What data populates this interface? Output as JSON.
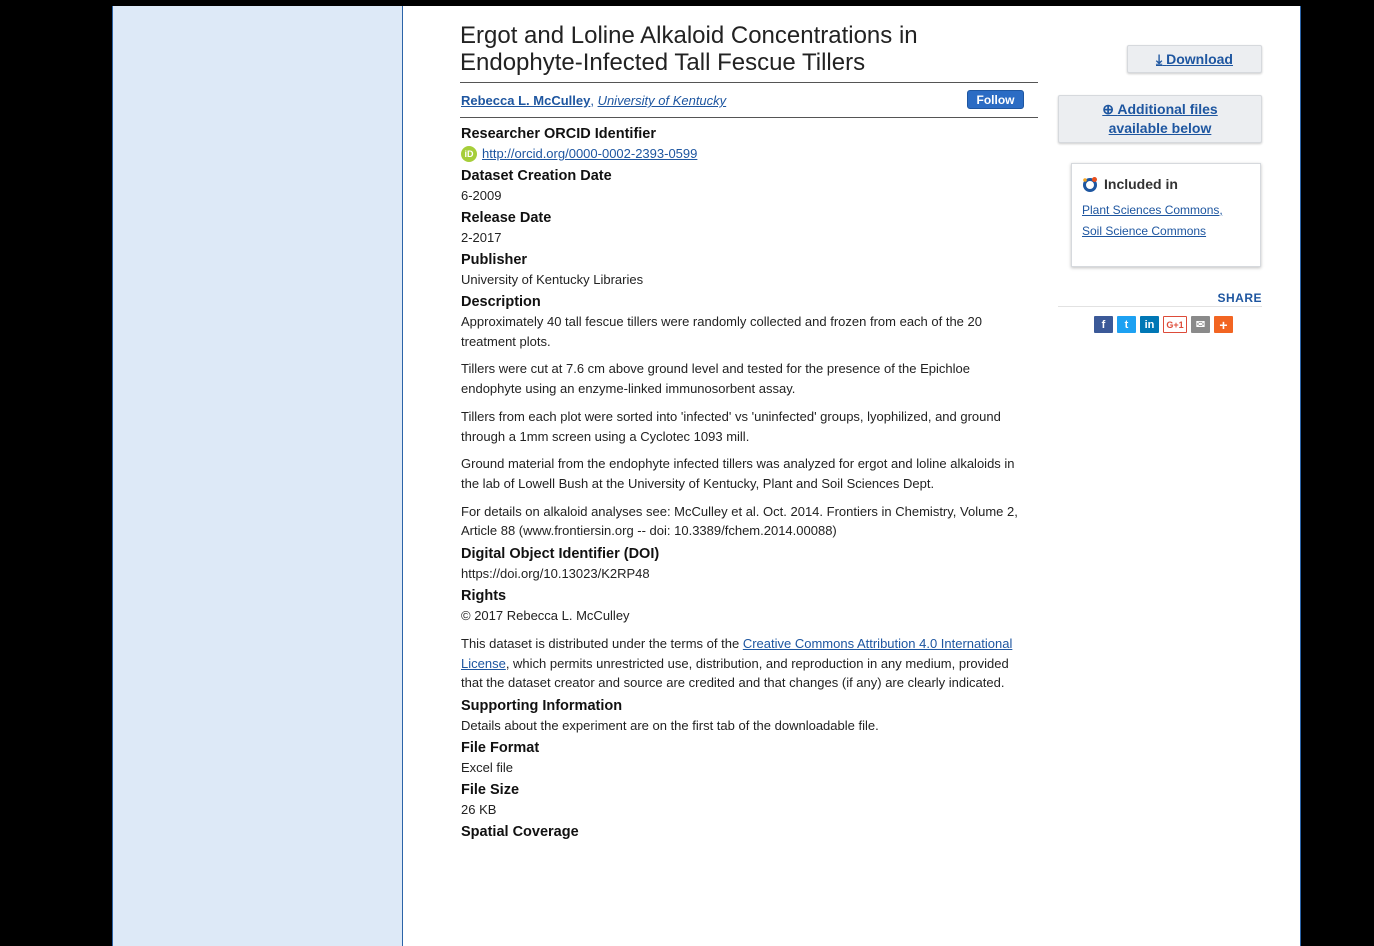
{
  "article": {
    "title_line1": "Ergot and Loline Alkaloid Concentrations in",
    "title_line2": "Endophyte-Infected Tall Fescue Tillers",
    "author_name": "Rebecca L. McCulley",
    "author_affiliation": "University of Kentucky",
    "follow_label": "Follow"
  },
  "fields": {
    "orcid_label": "Researcher ORCID Identifier",
    "orcid_badge": "iD",
    "orcid_url": "http://orcid.org/0000-0002-2393-0599",
    "creation_label": "Dataset Creation Date",
    "creation_value": "6-2009",
    "release_label": "Release Date",
    "release_value": "2-2017",
    "publisher_label": "Publisher",
    "publisher_value": "University of Kentucky Libraries",
    "description_label": "Description",
    "description_p1": "Approximately 40 tall fescue tillers were randomly collected and frozen from each of the 20 treatment plots.",
    "description_p2": "Tillers were cut at 7.6 cm above ground level and tested for the presence of the Epichloe endophyte using an enzyme-linked immunosorbent assay.",
    "description_p3": "Tillers from each plot were sorted into 'infected' vs 'uninfected' groups, lyophilized, and ground through a 1mm screen using a Cyclotec 1093 mill.",
    "description_p4": "Ground material from the endophyte infected tillers was analyzed for ergot and loline alkaloids in the lab of Lowell Bush at the University of Kentucky, Plant and Soil Sciences Dept.",
    "description_p5": "For details on alkaloid analyses see: McCulley et al. Oct. 2014. Frontiers in Chemistry, Volume 2, Article 88 (www.frontiersin.org -- doi: 10.3389/fchem.2014.00088)",
    "doi_label": "Digital Object Identifier (DOI)",
    "doi_value": "https://doi.org/10.13023/K2RP48",
    "rights_label": "Rights",
    "rights_value": "© 2017 Rebecca L. McCulley",
    "rights_text_before": "This dataset is distributed under the terms of the ",
    "rights_link": "Creative Commons Attribution 4.0 International License",
    "rights_text_after": ", which permits unrestricted use, distribution, and reproduction in any medium, provided that the dataset creator and source are credited and that changes (if any) are clearly indicated.",
    "supporting_label": "Supporting Information",
    "supporting_value": "Details about the experiment are on the first tab of the downloadable file.",
    "format_label": "File Format",
    "format_value": "Excel file",
    "size_label": "File Size",
    "size_value": "26 KB",
    "spatial_label": "Spatial Coverage"
  },
  "sidebar_right": {
    "download_label": "Download",
    "additional_line1": "Additional files",
    "additional_line2": "available below",
    "included_label": "Included in",
    "included_links": [
      "Plant Sciences Commons,",
      "Soil Science Commons"
    ],
    "share_label": "SHARE",
    "share_icons": [
      "facebook-icon",
      "twitter-icon",
      "linkedin-icon",
      "google-plus-icon",
      "email-icon",
      "addthis-plus-icon"
    ]
  },
  "colors": {
    "link": "#1e56a0",
    "sidebar_bg": "#dde9f7",
    "follow_btn": "#2b6cc4",
    "orcid_green": "#a6ce39"
  }
}
